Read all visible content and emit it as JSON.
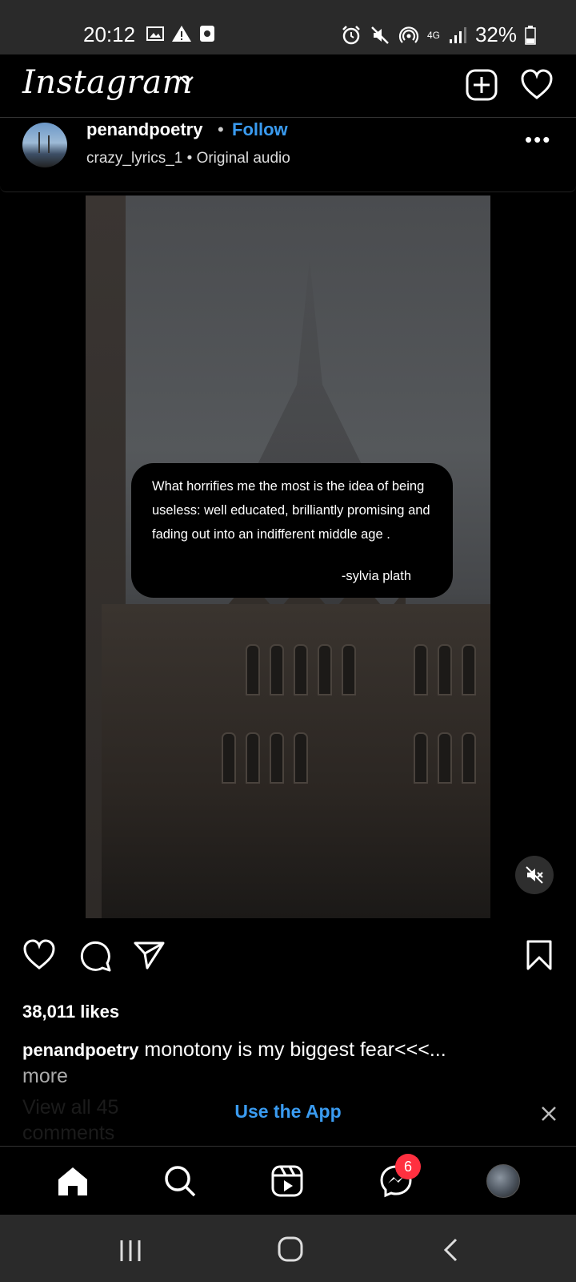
{
  "status_bar": {
    "time": "20:12",
    "network": "4G",
    "battery": "32%",
    "left_icons": [
      "image-icon",
      "warning-icon",
      "app-icon"
    ],
    "right_icons": [
      "alarm-icon",
      "mute-icon",
      "hotspot-icon",
      "signal-icon",
      "battery-icon"
    ]
  },
  "header": {
    "logo": "Instagram"
  },
  "post": {
    "username": "penandpoetry",
    "separator": "•",
    "follow_label": "Follow",
    "subtitle": "crazy_lyrics_1 • Original audio",
    "more_label": "•••",
    "quote_text": "What horrifies me the most is the idea of being useless: well educated, brilliantly promising and fading out into an indifferent middle age .",
    "quote_author": "-sylvia plath",
    "likes": "38,011 likes",
    "caption_user": "penandpoetry",
    "caption_text": " monotony is my biggest fear<<<...",
    "caption_more": "more",
    "comments_link": "View all 45 comments"
  },
  "banner": {
    "label": "Use the App"
  },
  "bottom_nav": {
    "badge_count": "6"
  },
  "colors": {
    "accent": "#3a9bf0",
    "badge": "#ff3040",
    "background": "#000000"
  }
}
